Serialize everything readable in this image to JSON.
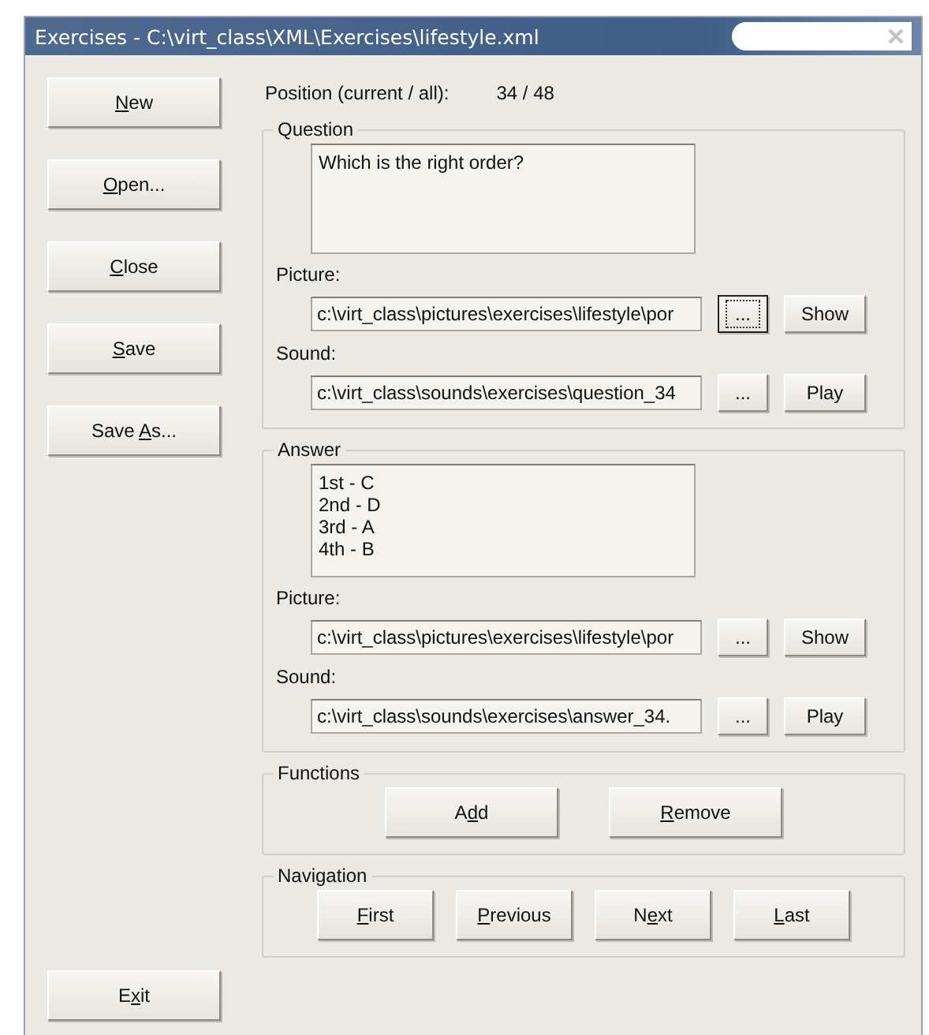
{
  "window": {
    "title": "Exercises - C:\\virt_class\\XML\\Exercises\\lifestyle.xml"
  },
  "side_buttons": [
    {
      "label": {
        "key": "N",
        "after": "ew"
      }
    },
    {
      "label": {
        "key": "O",
        "after": "pen..."
      }
    },
    {
      "label": {
        "key": "C",
        "after": "lose"
      }
    },
    {
      "label": {
        "key": "S",
        "after": "ave"
      }
    },
    {
      "label": {
        "before": "Save ",
        "key": "A",
        "after": "s..."
      }
    }
  ],
  "exit_button": {
    "label": {
      "before": "E",
      "key": "x",
      "after": "it"
    }
  },
  "position": {
    "label": "Position (current / all):",
    "value": "34 / 48"
  },
  "groups": [
    {
      "title": "Question",
      "text": "Which is the right order?",
      "picture_label": "Picture:",
      "picture_path": "c:\\virt_class\\pictures\\exercises\\lifestyle\\por",
      "picture_browse": {
        "label": "...",
        "focused": true
      },
      "picture_action": "Show",
      "sound_label": "Sound:",
      "sound_path": "c:\\virt_class\\sounds\\exercises\\question_34",
      "sound_browse": {
        "label": "...",
        "focused": false
      },
      "sound_action": "Play"
    },
    {
      "title": "Answer",
      "text": "1st - C\n2nd - D\n3rd - A\n4th - B",
      "picture_label": "Picture:",
      "picture_path": "c:\\virt_class\\pictures\\exercises\\lifestyle\\por",
      "picture_browse": {
        "label": "...",
        "focused": false
      },
      "picture_action": "Show",
      "sound_label": "Sound:",
      "sound_path": "c:\\virt_class\\sounds\\exercises\\answer_34.",
      "sound_browse": {
        "label": "...",
        "focused": false
      },
      "sound_action": "Play"
    }
  ],
  "functions": {
    "title": "Functions",
    "buttons": [
      {
        "label": {
          "before": "A",
          "key": "d",
          "after": "d"
        }
      },
      {
        "label": {
          "key": "R",
          "after": "emove"
        }
      }
    ]
  },
  "navigation": {
    "title": "Navigation",
    "buttons": [
      {
        "label": {
          "key": "F",
          "after": "irst"
        }
      },
      {
        "label": {
          "key": "P",
          "after": "revious"
        }
      },
      {
        "label": {
          "before": "N",
          "key": "e",
          "after": "xt"
        }
      },
      {
        "label": {
          "key": "L",
          "after": "ast"
        }
      }
    ]
  }
}
